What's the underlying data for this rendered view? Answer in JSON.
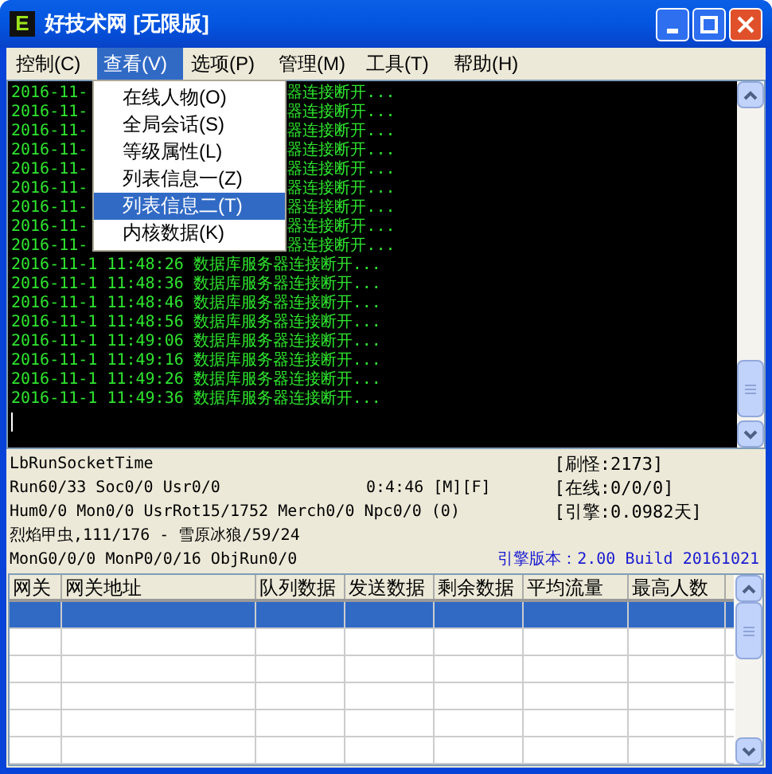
{
  "window": {
    "logo": "E",
    "title": "好技术网 [无限版]"
  },
  "menu": [
    {
      "label": "控制(C)",
      "selected": false
    },
    {
      "label": "查看(V)",
      "selected": true
    },
    {
      "label": "选项(P)",
      "selected": false
    },
    {
      "label": "管理(M)",
      "selected": false
    },
    {
      "label": "工具(T)",
      "selected": false
    },
    {
      "label": "帮助(H)",
      "selected": false
    }
  ],
  "dropdown": [
    {
      "label": "在线人物(O)",
      "selected": false
    },
    {
      "label": "全局会话(S)",
      "selected": false
    },
    {
      "label": "等级属性(L)",
      "selected": false
    },
    {
      "label": "列表信息一(Z)",
      "selected": false
    },
    {
      "label": "列表信息二(T)",
      "selected": true
    },
    {
      "label": "内核数据(K)",
      "selected": false
    }
  ],
  "log": [
    {
      "kind": "covered",
      "left": "2016-11-",
      "right": "器连接断开..."
    },
    {
      "kind": "covered",
      "left": "2016-11-",
      "right": "器连接断开..."
    },
    {
      "kind": "covered",
      "left": "2016-11-",
      "right": "器连接断开..."
    },
    {
      "kind": "covered",
      "left": "2016-11-",
      "right": "器连接断开..."
    },
    {
      "kind": "covered",
      "left": "2016-11-",
      "right": "器连接断开..."
    },
    {
      "kind": "covered",
      "left": "2016-11-",
      "right": "器连接断开..."
    },
    {
      "kind": "covered",
      "left": "2016-11-",
      "right": "器连接断开..."
    },
    {
      "kind": "covered",
      "left": "2016-11-",
      "right": "器连接断开..."
    },
    {
      "kind": "covered",
      "left": "2016-11-",
      "right": "器连接断开..."
    },
    {
      "kind": "full",
      "text": "2016-11-1 11:48:26 数据库服务器连接断开..."
    },
    {
      "kind": "full",
      "text": "2016-11-1 11:48:36 数据库服务器连接断开..."
    },
    {
      "kind": "full",
      "text": "2016-11-1 11:48:46 数据库服务器连接断开..."
    },
    {
      "kind": "full",
      "text": "2016-11-1 11:48:56 数据库服务器连接断开..."
    },
    {
      "kind": "full",
      "text": "2016-11-1 11:49:06 数据库服务器连接断开..."
    },
    {
      "kind": "full",
      "text": "2016-11-1 11:49:16 数据库服务器连接断开..."
    },
    {
      "kind": "full",
      "text": "2016-11-1 11:49:26 数据库服务器连接断开..."
    },
    {
      "kind": "full",
      "text": "2016-11-1 11:49:36 数据库服务器连接断开..."
    }
  ],
  "info": {
    "lines": [
      {
        "text": "LbRunSocketTime"
      },
      {
        "text": "Run60/33 Soc0/0 Usr0/0",
        "aside": "0:4:46 [M][F]"
      },
      {
        "text": "Hum0/0 Mon0/0 UsrRot15/1752 Merch0/0 Npc0/0 (0)"
      },
      {
        "text": "烈焰甲虫,111/176 - 雪原冰狼/59/24"
      },
      {
        "text": "MonG0/0/0 MonP0/0/16 ObjRun0/0"
      }
    ],
    "stats": [
      "[刷怪:2173]",
      "[在线:0/0/0]",
      "[引擎:0.0982天]"
    ],
    "version": "引擎版本：2.00 Build 20161021"
  },
  "table": {
    "columns": [
      "网关",
      "网关地址",
      "队列数据",
      "发送数据",
      "剩余数据",
      "平均流量",
      "最高人数"
    ],
    "rows": [
      {
        "selected": true
      },
      {
        "selected": false
      },
      {
        "selected": false
      },
      {
        "selected": false
      },
      {
        "selected": false
      },
      {
        "selected": false
      }
    ]
  }
}
